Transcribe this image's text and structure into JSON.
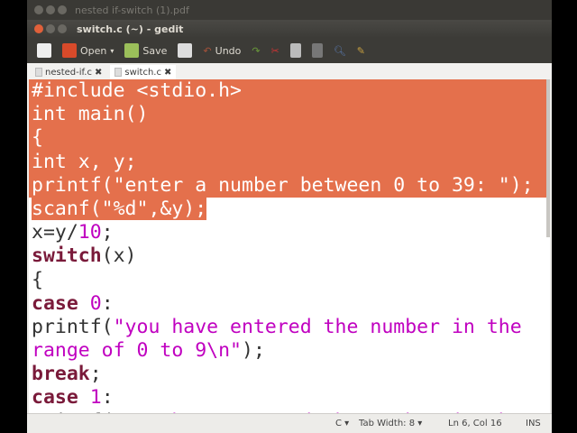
{
  "background_window": {
    "title": "nested if-switch (1).pdf"
  },
  "window": {
    "title": "switch.c (~) - gedit"
  },
  "toolbar": {
    "open_label": "Open",
    "save_label": "Save",
    "undo_label": "Undo"
  },
  "tabs": [
    {
      "label": "nested-if.c"
    },
    {
      "label": "switch.c"
    }
  ],
  "code": [
    {
      "sel": "full",
      "tokens": [
        {
          "t": "#include <stdio.h>",
          "c": ""
        }
      ]
    },
    {
      "sel": "full",
      "tokens": [
        {
          "t": "int",
          "c": ""
        },
        {
          "t": " main()",
          "c": ""
        }
      ]
    },
    {
      "sel": "full",
      "tokens": [
        {
          "t": "{",
          "c": ""
        }
      ]
    },
    {
      "sel": "full",
      "tokens": [
        {
          "t": "int",
          "c": ""
        },
        {
          "t": " x, y;",
          "c": ""
        }
      ]
    },
    {
      "sel": "full",
      "tokens": [
        {
          "t": "printf(\"enter a number between 0 to 39: \");",
          "c": ""
        }
      ]
    },
    {
      "sel": "text",
      "tokens": [
        {
          "t": "scanf(\"%d\",&y);",
          "c": ""
        }
      ]
    },
    {
      "sel": "",
      "tokens": [
        {
          "t": "x=y/",
          "c": ""
        },
        {
          "t": "10",
          "c": "num"
        },
        {
          "t": ";",
          "c": ""
        }
      ]
    },
    {
      "sel": "",
      "tokens": [
        {
          "t": "switch",
          "c": "kw"
        },
        {
          "t": "(x)",
          "c": ""
        }
      ]
    },
    {
      "sel": "",
      "tokens": [
        {
          "t": "{",
          "c": ""
        }
      ]
    },
    {
      "sel": "",
      "tokens": [
        {
          "t": "case",
          "c": "kw"
        },
        {
          "t": " ",
          "c": ""
        },
        {
          "t": "0",
          "c": "num"
        },
        {
          "t": ":",
          "c": ""
        }
      ]
    },
    {
      "sel": "",
      "tokens": [
        {
          "t": "printf(",
          "c": ""
        },
        {
          "t": "\"you have entered the number in the",
          "c": "str"
        }
      ]
    },
    {
      "sel": "",
      "tokens": [
        {
          "t": "range of 0 to 9\\n\"",
          "c": "str"
        },
        {
          "t": ");",
          "c": ""
        }
      ]
    },
    {
      "sel": "",
      "tokens": [
        {
          "t": "break",
          "c": "kw"
        },
        {
          "t": ";",
          "c": ""
        }
      ]
    },
    {
      "sel": "",
      "tokens": [
        {
          "t": "case",
          "c": "kw"
        },
        {
          "t": " ",
          "c": ""
        },
        {
          "t": "1",
          "c": "num"
        },
        {
          "t": ":",
          "c": ""
        }
      ]
    },
    {
      "sel": "",
      "tokens": [
        {
          "t": "printf(",
          "c": ""
        },
        {
          "t": "\"you have entered the number in the",
          "c": "str"
        }
      ]
    }
  ],
  "status": {
    "language": "C",
    "tab_width": "Tab Width: 8",
    "position": "Ln 6, Col 16",
    "mode": "INS"
  }
}
